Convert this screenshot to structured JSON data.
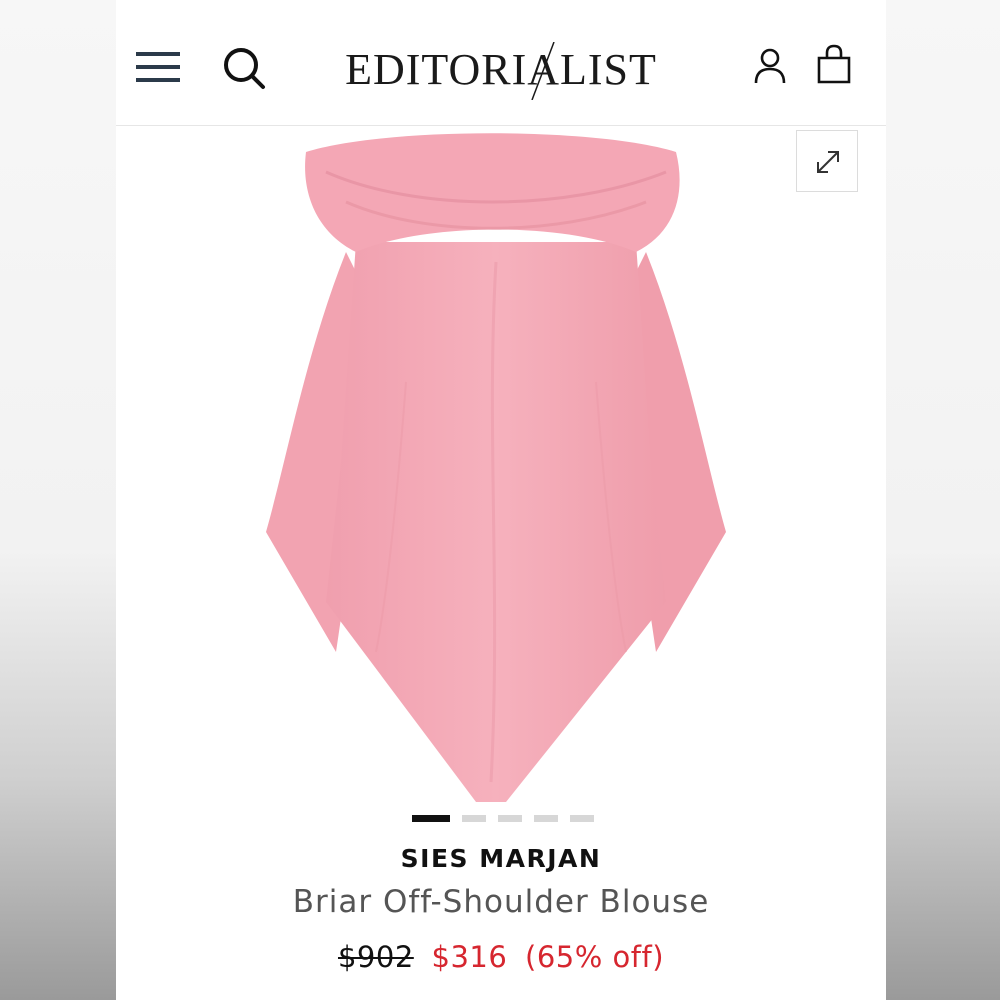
{
  "header": {
    "logo_text": "EDITORIALIST",
    "icons": [
      "hamburger-menu-icon",
      "search-icon",
      "account-icon",
      "shopping-bag-icon"
    ]
  },
  "product": {
    "brand": "SIES MARJAN",
    "name": "Briar Off-Shoulder Blouse",
    "price_original": "$902",
    "price_sale": "$316",
    "discount": "(65% off)",
    "image_color": "#f4a9b6"
  },
  "carousel": {
    "total_images": 5,
    "active_index": 0
  },
  "colors": {
    "sale": "#d6262f",
    "text": "#111111",
    "muted": "#555555"
  }
}
